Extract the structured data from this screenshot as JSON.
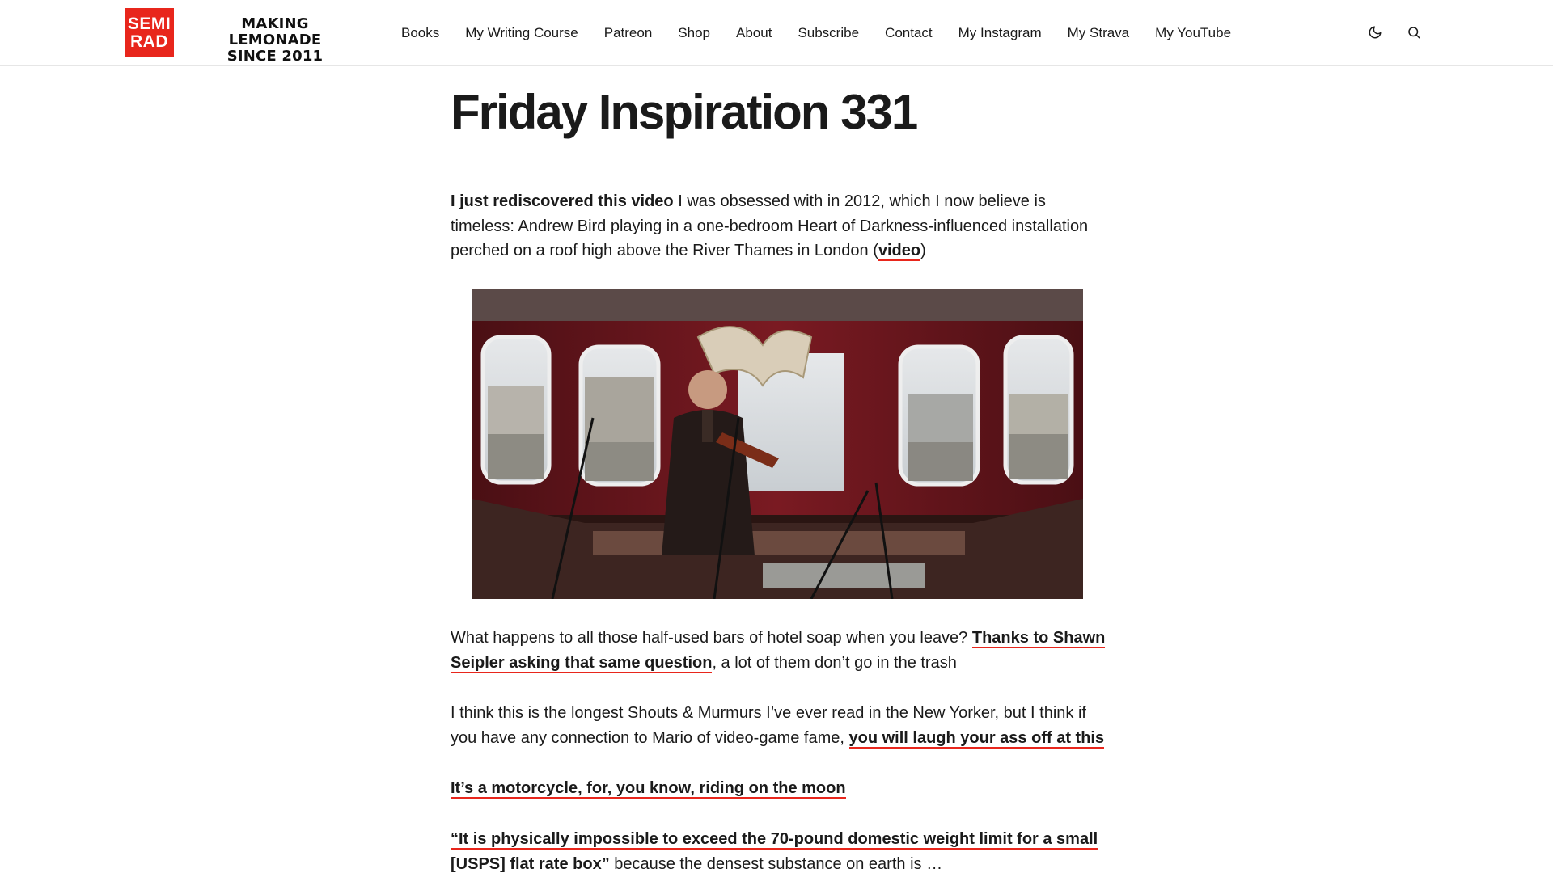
{
  "header": {
    "logo_line1": "SEMI",
    "logo_line2": "RAD",
    "tagline_line1": "MAKING LEMONADE",
    "tagline_line2": "SINCE 2011",
    "brand_color": "#e8261c",
    "nav": [
      {
        "label": "Books"
      },
      {
        "label": "My Writing Course"
      },
      {
        "label": "Patreon"
      },
      {
        "label": "Shop"
      },
      {
        "label": "About"
      },
      {
        "label": "Subscribe"
      },
      {
        "label": "Contact"
      },
      {
        "label": "My Instagram"
      },
      {
        "label": "My Strava"
      },
      {
        "label": "My YouTube"
      }
    ],
    "icons": [
      "moon-icon",
      "search-icon"
    ]
  },
  "post": {
    "title": "Friday Inspiration 331",
    "p1": {
      "bold_lead": "I just rediscovered this video",
      "text": " I was obsessed with in 2012, which I now believe is timeless: Andrew Bird playing in a one-bedroom Heart of Darkness-influenced installation perched on a roof high above the River Thames in London (",
      "link": "video",
      "tail": ")"
    },
    "p2": {
      "text": "What happens to all those half-used bars of hotel soap when you leave? ",
      "link": "Thanks to Shawn Seipler asking that same question",
      "tail": ", a lot of them don’t go in the trash"
    },
    "p3": {
      "text": "I think this is the longest Shouts & Murmurs I’ve ever read in the New Yorker, but I think if you have any connection to Mario of video-game fame, ",
      "link": "you will laugh your ass off at this"
    },
    "p4": {
      "link": "It’s a motorcycle, for, you know, riding on the moon"
    },
    "p5": {
      "link": "“It is physically impossible to exceed the 70-pound domestic weight limit for a small [USPS] flat rate box”",
      "tail": " because the densest substance on earth is …"
    }
  }
}
